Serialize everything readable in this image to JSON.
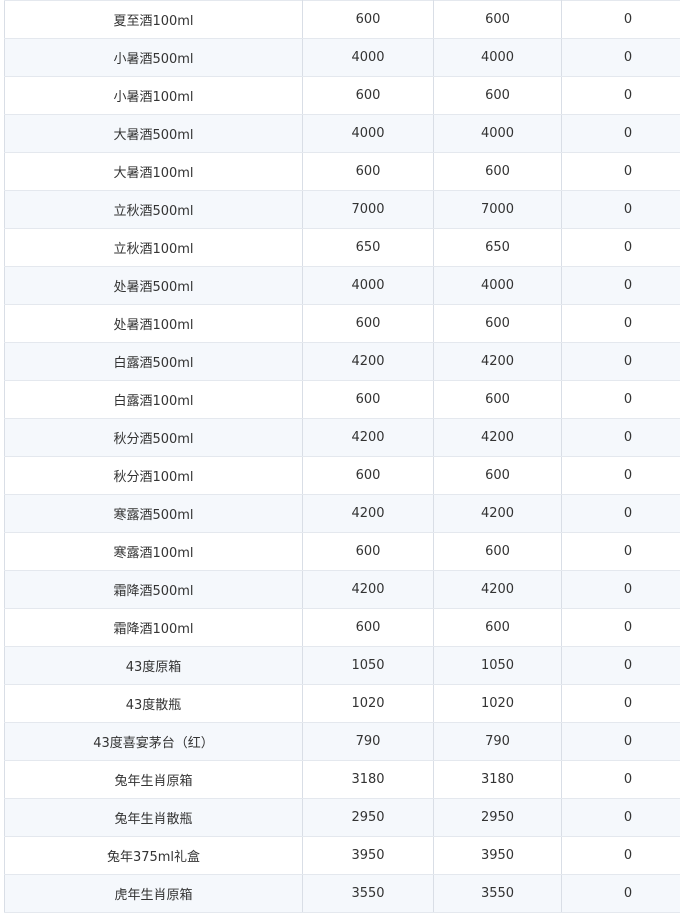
{
  "table": {
    "rows": [
      [
        "夏至酒100ml",
        "600",
        "600",
        "0"
      ],
      [
        "小暑酒500ml",
        "4000",
        "4000",
        "0"
      ],
      [
        "小暑酒100ml",
        "600",
        "600",
        "0"
      ],
      [
        "大暑酒500ml",
        "4000",
        "4000",
        "0"
      ],
      [
        "大暑酒100ml",
        "600",
        "600",
        "0"
      ],
      [
        "立秋酒500ml",
        "7000",
        "7000",
        "0"
      ],
      [
        "立秋酒100ml",
        "650",
        "650",
        "0"
      ],
      [
        "处暑酒500ml",
        "4000",
        "4000",
        "0"
      ],
      [
        "处暑酒100ml",
        "600",
        "600",
        "0"
      ],
      [
        "白露酒500ml",
        "4200",
        "4200",
        "0"
      ],
      [
        "白露酒100ml",
        "600",
        "600",
        "0"
      ],
      [
        "秋分酒500ml",
        "4200",
        "4200",
        "0"
      ],
      [
        "秋分酒100ml",
        "600",
        "600",
        "0"
      ],
      [
        "寒露酒500ml",
        "4200",
        "4200",
        "0"
      ],
      [
        "寒露酒100ml",
        "600",
        "600",
        "0"
      ],
      [
        "霜降酒500ml",
        "4200",
        "4200",
        "0"
      ],
      [
        "霜降酒100ml",
        "600",
        "600",
        "0"
      ],
      [
        "43度原箱",
        "1050",
        "1050",
        "0"
      ],
      [
        "43度散瓶",
        "1020",
        "1020",
        "0"
      ],
      [
        "43度喜宴茅台（红）",
        "790",
        "790",
        "0"
      ],
      [
        "兔年生肖原箱",
        "3180",
        "3180",
        "0"
      ],
      [
        "兔年生肖散瓶",
        "2950",
        "2950",
        "0"
      ],
      [
        "兔年375ml礼盒",
        "3950",
        "3950",
        "0"
      ],
      [
        "虎年生肖原箱",
        "3550",
        "3550",
        "0"
      ]
    ]
  }
}
